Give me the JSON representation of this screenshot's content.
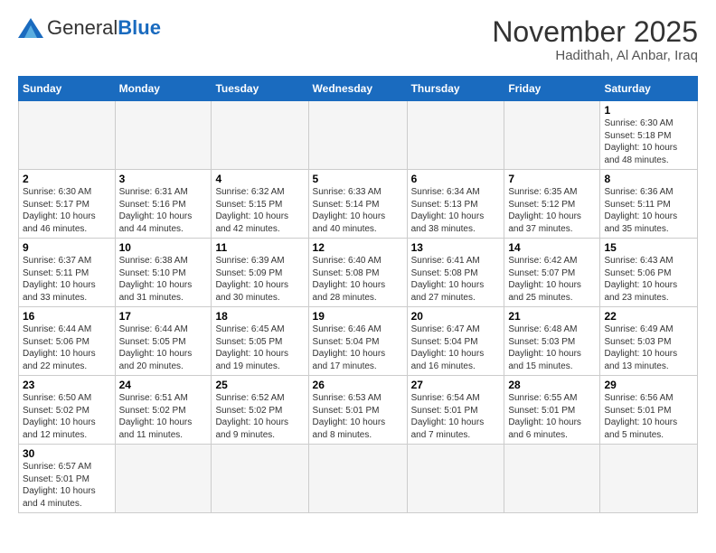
{
  "logo": {
    "text_general": "General",
    "text_blue": "Blue"
  },
  "title": {
    "month_year": "November 2025",
    "location": "Hadithah, Al Anbar, Iraq"
  },
  "weekdays": [
    "Sunday",
    "Monday",
    "Tuesday",
    "Wednesday",
    "Thursday",
    "Friday",
    "Saturday"
  ],
  "weeks": [
    [
      {
        "day": "",
        "info": "",
        "empty": true
      },
      {
        "day": "",
        "info": "",
        "empty": true
      },
      {
        "day": "",
        "info": "",
        "empty": true
      },
      {
        "day": "",
        "info": "",
        "empty": true
      },
      {
        "day": "",
        "info": "",
        "empty": true
      },
      {
        "day": "",
        "info": "",
        "empty": true
      },
      {
        "day": "1",
        "info": "Sunrise: 6:30 AM\nSunset: 5:18 PM\nDaylight: 10 hours\nand 48 minutes."
      }
    ],
    [
      {
        "day": "2",
        "info": "Sunrise: 6:30 AM\nSunset: 5:17 PM\nDaylight: 10 hours\nand 46 minutes."
      },
      {
        "day": "3",
        "info": "Sunrise: 6:31 AM\nSunset: 5:16 PM\nDaylight: 10 hours\nand 44 minutes."
      },
      {
        "day": "4",
        "info": "Sunrise: 6:32 AM\nSunset: 5:15 PM\nDaylight: 10 hours\nand 42 minutes."
      },
      {
        "day": "5",
        "info": "Sunrise: 6:33 AM\nSunset: 5:14 PM\nDaylight: 10 hours\nand 40 minutes."
      },
      {
        "day": "6",
        "info": "Sunrise: 6:34 AM\nSunset: 5:13 PM\nDaylight: 10 hours\nand 38 minutes."
      },
      {
        "day": "7",
        "info": "Sunrise: 6:35 AM\nSunset: 5:12 PM\nDaylight: 10 hours\nand 37 minutes."
      },
      {
        "day": "8",
        "info": "Sunrise: 6:36 AM\nSunset: 5:11 PM\nDaylight: 10 hours\nand 35 minutes."
      }
    ],
    [
      {
        "day": "9",
        "info": "Sunrise: 6:37 AM\nSunset: 5:11 PM\nDaylight: 10 hours\nand 33 minutes."
      },
      {
        "day": "10",
        "info": "Sunrise: 6:38 AM\nSunset: 5:10 PM\nDaylight: 10 hours\nand 31 minutes."
      },
      {
        "day": "11",
        "info": "Sunrise: 6:39 AM\nSunset: 5:09 PM\nDaylight: 10 hours\nand 30 minutes."
      },
      {
        "day": "12",
        "info": "Sunrise: 6:40 AM\nSunset: 5:08 PM\nDaylight: 10 hours\nand 28 minutes."
      },
      {
        "day": "13",
        "info": "Sunrise: 6:41 AM\nSunset: 5:08 PM\nDaylight: 10 hours\nand 27 minutes."
      },
      {
        "day": "14",
        "info": "Sunrise: 6:42 AM\nSunset: 5:07 PM\nDaylight: 10 hours\nand 25 minutes."
      },
      {
        "day": "15",
        "info": "Sunrise: 6:43 AM\nSunset: 5:06 PM\nDaylight: 10 hours\nand 23 minutes."
      }
    ],
    [
      {
        "day": "16",
        "info": "Sunrise: 6:44 AM\nSunset: 5:06 PM\nDaylight: 10 hours\nand 22 minutes."
      },
      {
        "day": "17",
        "info": "Sunrise: 6:44 AM\nSunset: 5:05 PM\nDaylight: 10 hours\nand 20 minutes."
      },
      {
        "day": "18",
        "info": "Sunrise: 6:45 AM\nSunset: 5:05 PM\nDaylight: 10 hours\nand 19 minutes."
      },
      {
        "day": "19",
        "info": "Sunrise: 6:46 AM\nSunset: 5:04 PM\nDaylight: 10 hours\nand 17 minutes."
      },
      {
        "day": "20",
        "info": "Sunrise: 6:47 AM\nSunset: 5:04 PM\nDaylight: 10 hours\nand 16 minutes."
      },
      {
        "day": "21",
        "info": "Sunrise: 6:48 AM\nSunset: 5:03 PM\nDaylight: 10 hours\nand 15 minutes."
      },
      {
        "day": "22",
        "info": "Sunrise: 6:49 AM\nSunset: 5:03 PM\nDaylight: 10 hours\nand 13 minutes."
      }
    ],
    [
      {
        "day": "23",
        "info": "Sunrise: 6:50 AM\nSunset: 5:02 PM\nDaylight: 10 hours\nand 12 minutes."
      },
      {
        "day": "24",
        "info": "Sunrise: 6:51 AM\nSunset: 5:02 PM\nDaylight: 10 hours\nand 11 minutes."
      },
      {
        "day": "25",
        "info": "Sunrise: 6:52 AM\nSunset: 5:02 PM\nDaylight: 10 hours\nand 9 minutes."
      },
      {
        "day": "26",
        "info": "Sunrise: 6:53 AM\nSunset: 5:01 PM\nDaylight: 10 hours\nand 8 minutes."
      },
      {
        "day": "27",
        "info": "Sunrise: 6:54 AM\nSunset: 5:01 PM\nDaylight: 10 hours\nand 7 minutes."
      },
      {
        "day": "28",
        "info": "Sunrise: 6:55 AM\nSunset: 5:01 PM\nDaylight: 10 hours\nand 6 minutes."
      },
      {
        "day": "29",
        "info": "Sunrise: 6:56 AM\nSunset: 5:01 PM\nDaylight: 10 hours\nand 5 minutes."
      }
    ],
    [
      {
        "day": "30",
        "info": "Sunrise: 6:57 AM\nSunset: 5:01 PM\nDaylight: 10 hours\nand 4 minutes."
      },
      {
        "day": "",
        "info": "",
        "empty": true
      },
      {
        "day": "",
        "info": "",
        "empty": true
      },
      {
        "day": "",
        "info": "",
        "empty": true
      },
      {
        "day": "",
        "info": "",
        "empty": true
      },
      {
        "day": "",
        "info": "",
        "empty": true
      },
      {
        "day": "",
        "info": "",
        "empty": true
      }
    ]
  ]
}
